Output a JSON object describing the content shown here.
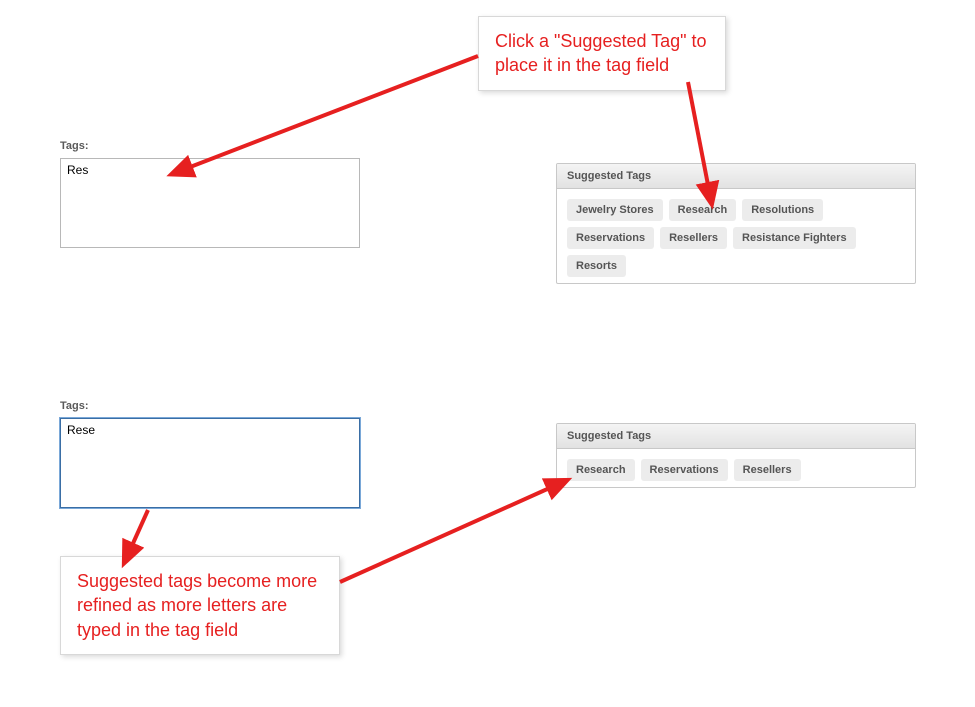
{
  "callouts": {
    "top": "Click a \"Suggested Tag\" to place it in the tag field",
    "bottom": "Suggested tags become more refined as more letters are typed in the tag field"
  },
  "section1": {
    "label": "Tags:",
    "inputValue": "Res",
    "suggestedHeader": "Suggested Tags",
    "tags": [
      "Jewelry Stores",
      "Research",
      "Resolutions",
      "Reservations",
      "Resellers",
      "Resistance Fighters",
      "Resorts"
    ]
  },
  "section2": {
    "label": "Tags:",
    "inputValue": "Rese",
    "suggestedHeader": "Suggested Tags",
    "tags": [
      "Research",
      "Reservations",
      "Resellers"
    ]
  }
}
